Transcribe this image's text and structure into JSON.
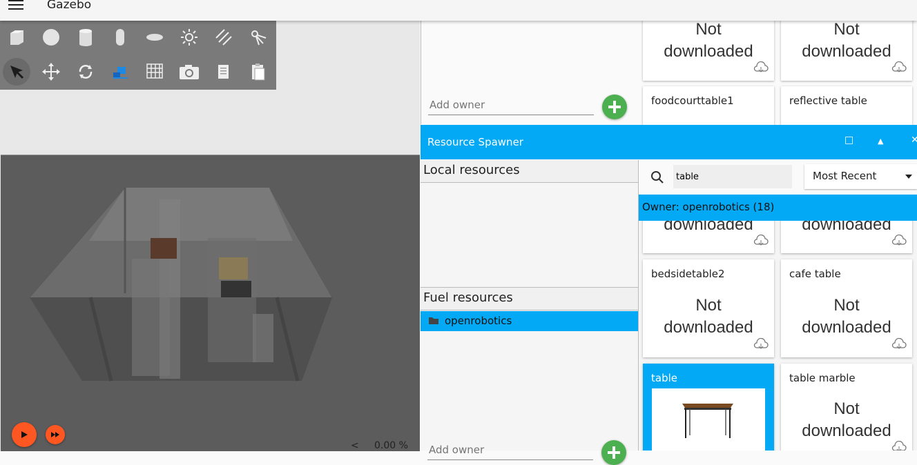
{
  "app": {
    "title": "Gazebo"
  },
  "toolbar": {
    "row1": [
      "box-icon",
      "sphere-icon",
      "cylinder-icon",
      "capsule-icon",
      "ellipsoid-icon",
      "sun-light-icon",
      "directional-light-icon",
      "spot-light-icon"
    ],
    "row2": [
      "select-icon",
      "translate-icon",
      "rotate-icon",
      "transform-icon",
      "grid-icon",
      "camera-icon",
      "copy-icon",
      "paste-icon"
    ]
  },
  "controls": {
    "rtf": "0.00 %",
    "rtf_arrow": "<"
  },
  "owner_input": {
    "placeholder": "Add owner"
  },
  "top_cards": [
    {
      "status_line1": "Not",
      "status_line2": "downloaded"
    },
    {
      "status_line1": "Not",
      "status_line2": "downloaded"
    },
    {
      "title": "foodcourttable1"
    },
    {
      "title": "reflective table"
    }
  ],
  "spawner": {
    "title": "Resource Spawner",
    "local_heading": "Local resources",
    "fuel_heading": "Fuel resources",
    "owner_item": "openrobotics",
    "search_value": "table",
    "sort_value": "Most Recent",
    "owner_banner": "Owner: openrobotics (18)"
  },
  "grid_cards": [
    {
      "title": "",
      "status_line1": "",
      "status_line2": "downloaded"
    },
    {
      "title": "",
      "status_line1": "",
      "status_line2": "downloaded"
    },
    {
      "title": "bedsidetable2",
      "status_line1": "Not",
      "status_line2": "downloaded"
    },
    {
      "title": "cafe table",
      "status_line1": "Not",
      "status_line2": "downloaded"
    },
    {
      "title": "table",
      "selected": true
    },
    {
      "title": "table marble",
      "status_line1": "Not",
      "status_line2": "downloaded"
    }
  ],
  "colors": {
    "accent": "#03a9f4",
    "play": "#ff5722",
    "add": "#4caf50"
  }
}
